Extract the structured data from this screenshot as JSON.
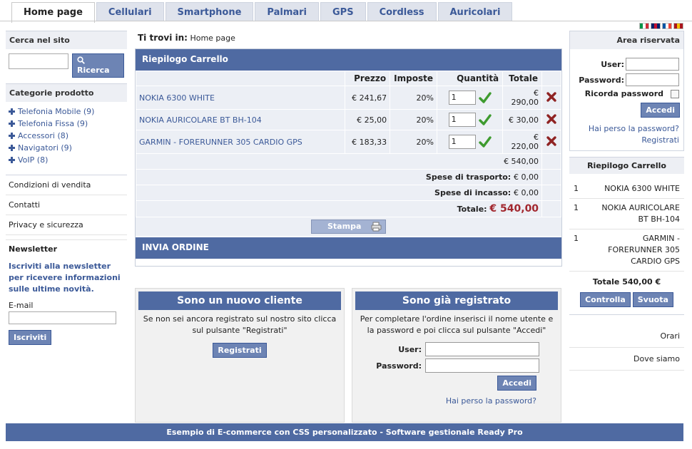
{
  "nav": {
    "tabs": [
      {
        "label": "Home page"
      },
      {
        "label": "Cellulari"
      },
      {
        "label": "Smartphone"
      },
      {
        "label": "Palmari"
      },
      {
        "label": "GPS"
      },
      {
        "label": "Cordless"
      },
      {
        "label": "Auricolari"
      }
    ],
    "flag_colors": {
      "it": [
        "#009246",
        "#ffffff",
        "#ce2b37"
      ],
      "uk": [
        "#012169",
        "#c8102e",
        "#012169"
      ],
      "fr": [
        "#0055a4",
        "#ffffff",
        "#ef4135"
      ],
      "es": [
        "#aa151b",
        "#f1bf00",
        "#aa151b"
      ]
    }
  },
  "left": {
    "search_title": "Cerca nel sito",
    "search_button": "Ricerca",
    "categories_title": "Categorie prodotto",
    "categories": [
      {
        "label": "Telefonia Mobile (9)"
      },
      {
        "label": "Telefonia Fissa (9)"
      },
      {
        "label": "Accessori (8)"
      },
      {
        "label": "Navigatori (9)"
      },
      {
        "label": "VoIP (8)"
      }
    ],
    "links": [
      {
        "label": "Condizioni di vendita"
      },
      {
        "label": "Contatti"
      },
      {
        "label": "Privacy e sicurezza"
      }
    ],
    "newsletter_title": "Newsletter",
    "newsletter_text": "Iscriviti alla newsletter per ricevere informazioni sulle ultime novità.",
    "email_label": "E-mail",
    "subscribe_button": "Iscriviti"
  },
  "breadcrumb": {
    "prefix": "Ti trovi in:",
    "current": "Home page"
  },
  "cart": {
    "title": "Riepilogo Carrello",
    "headers": {
      "price": "Prezzo",
      "tax": "Imposte",
      "qty": "Quantità",
      "total": "Totale"
    },
    "rows": [
      {
        "product": "NOKIA 6300 WHITE",
        "price": "€ 241,67",
        "tax": "20%",
        "qty": "1",
        "total": "€ 290,00"
      },
      {
        "product": "NOKIA AURICOLARE BT BH-104",
        "price": "€ 25,00",
        "tax": "20%",
        "qty": "1",
        "total": "€ 30,00"
      },
      {
        "product": "GARMIN - FORERUNNER 305 CARDIO GPS",
        "price": "€ 183,33",
        "tax": "20%",
        "qty": "1",
        "total": "€ 220,00"
      }
    ],
    "subtotal": "€ 540,00",
    "shipping_label": "Spese di trasporto:",
    "shipping_value": "€ 0,00",
    "cod_label": "Spese di incasso:",
    "cod_value": "€ 0,00",
    "total_label": "Totale:",
    "total_value": "€ 540,00",
    "print_button": "Stampa",
    "order_bar": "INVIA ORDINE"
  },
  "new_customer": {
    "title": "Sono un nuovo cliente",
    "text": "Se non sei ancora registrato sul nostro sito clicca sul pulsante \"Registrati\"",
    "button": "Registrati"
  },
  "registered": {
    "title": "Sono già registrato",
    "text": "Per completare l'ordine inserisci il nome utente e la password e poi clicca sul pulsante \"Accedi\"",
    "user_label": "User:",
    "password_label": "Password:",
    "button": "Accedi",
    "lost_password": "Hai perso la password?"
  },
  "right": {
    "area_title": "Area riservata",
    "user_label": "User:",
    "password_label": "Password:",
    "remember_label": "Ricorda password",
    "login_button": "Accedi",
    "lost_password": "Hai perso la password?",
    "register_link": "Registrati",
    "cart_title": "Riepilogo Carrello",
    "cart_items": [
      {
        "qty": "1",
        "name": "NOKIA 6300 WHITE"
      },
      {
        "qty": "1",
        "name": "NOKIA AURICOLARE BT BH-104"
      },
      {
        "qty": "1",
        "name": "GARMIN - FORERUNNER 305 CARDIO GPS"
      }
    ],
    "cart_total": "Totale 540,00 €",
    "check_button": "Controlla",
    "empty_button": "Svuota",
    "links": [
      {
        "label": "Orari"
      },
      {
        "label": "Dove siamo"
      }
    ]
  },
  "footer": {
    "text": "Esempio di E-commerce con CSS personalizzato - Software gestionale Ready Pro"
  }
}
